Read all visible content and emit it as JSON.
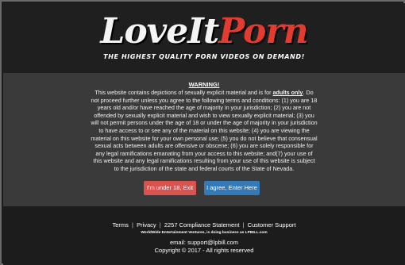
{
  "header": {
    "logo_part1": "LoveIt",
    "logo_part2": "Porn",
    "tagline": "THE HIGHEST QUALITY PORN VIDEOS ON DEMAND!"
  },
  "warning": {
    "title": "WARNING!",
    "body_before": "This website contains depictions of sexually explicit material and is for ",
    "body_emphasis": "adults only",
    "body_after": ". Do not proceed further unless you agree to the following terms and conditions: (1) you are 18 years old and/or have reached the age of majority in your jurisdiction; (2) you are not offended by sexually explicit material and wish to view sexually explicit material; (3) you will not permit persons under the age of 18 or under the age of majority in your jurisdiction to have access to or see any of the material on this website; (4) you are viewing the material on this website for your own personal use; (5) you do not believe that consensual sexual acts between adults are offensive or obscene; (6) you are solely responsible for any legal ramifications emanating from your access to this website; and(7) your use of this website and any legal ramifications resulting from your use of this website is subject to the jurisdiction of the state and federal courts of the State of Nevada.",
    "exit_label": "I'm under 18, Exit",
    "enter_label": "I agree, Enter Here"
  },
  "footer": {
    "links": [
      "Terms",
      "Privacy",
      "2257 Compliance Statement",
      "Customer Support"
    ],
    "separator": "|",
    "company": "WorldWide Entertainment Ventures, is doing business as LPBILL.com",
    "email": "email: support@lpbill.com",
    "copyright": "Copyright © 2017 - All rights reserved"
  },
  "colors": {
    "logo_accent": "#e33b2e",
    "exit_button": "#d9534f",
    "enter_button": "#337ab7",
    "warning_panel": "#3a3a3a"
  }
}
